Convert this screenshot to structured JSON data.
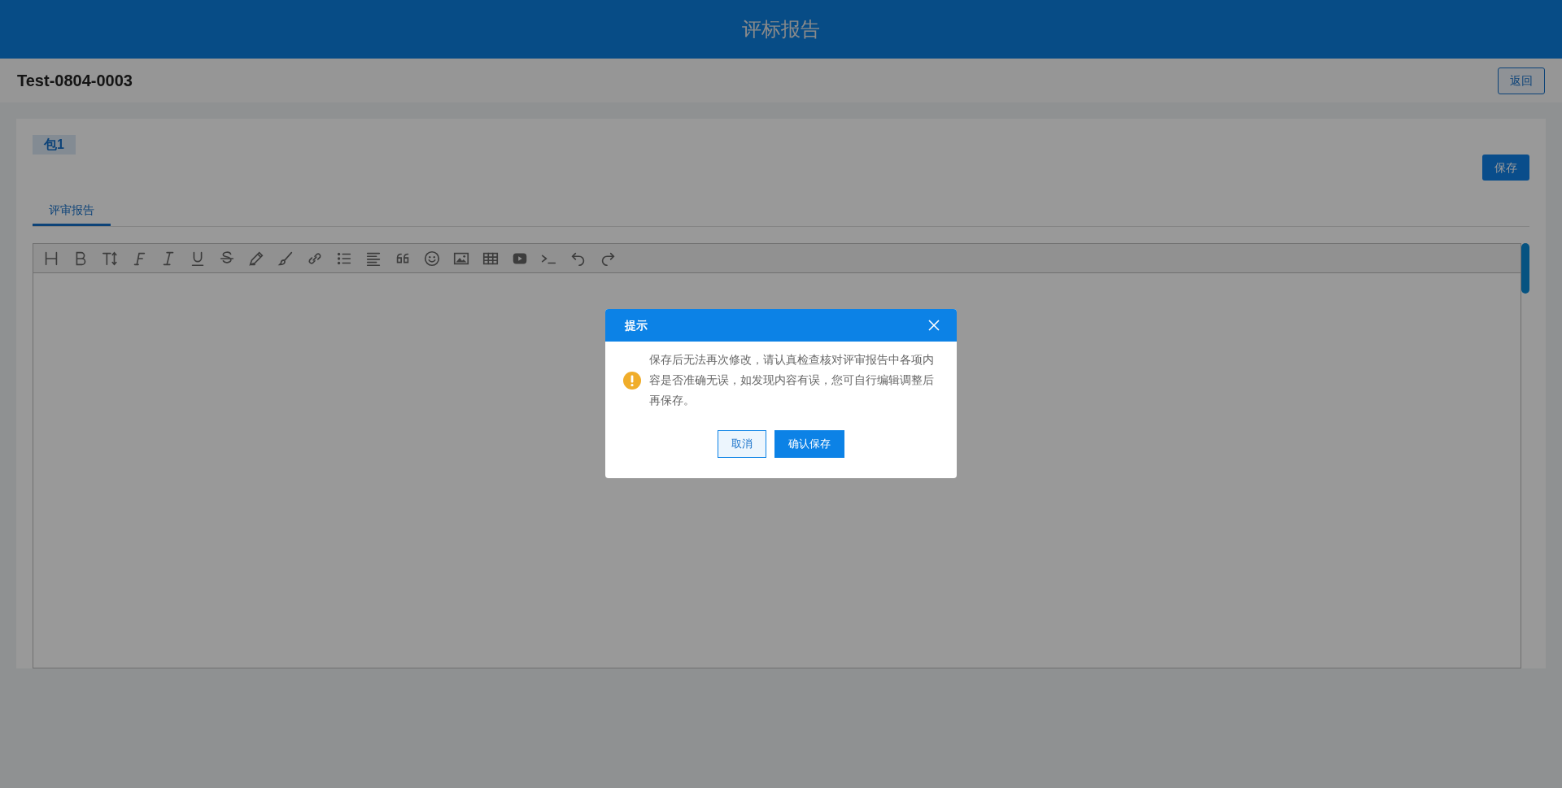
{
  "header": {
    "title": "评标报告"
  },
  "subheader": {
    "title": "Test-0804-0003",
    "back_button": "返回"
  },
  "package_tag": "包1",
  "save_button": "保存",
  "tabs": [
    {
      "label": "评审报告",
      "selected": true
    }
  ],
  "dialog": {
    "title": "提示",
    "message": "保存后无法再次修改，请认真检查核对评审报告中各项内容是否准确无误，如发现内容有误，您可自行编辑调整后再保存。",
    "buttons": [
      {
        "label": "取消",
        "kind": "secondary"
      },
      {
        "label": "确认保存",
        "kind": "primary"
      }
    ]
  }
}
